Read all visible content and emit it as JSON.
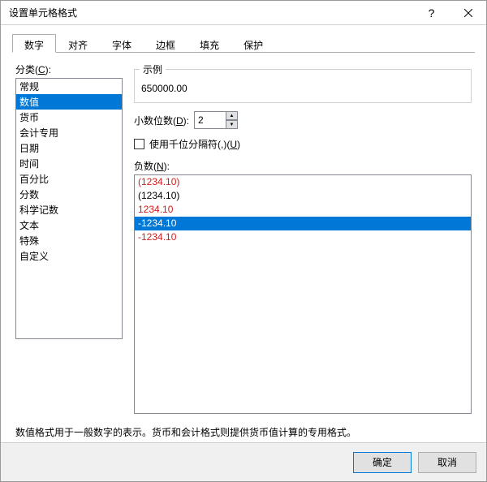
{
  "title": "设置单元格格式",
  "tabs": [
    "数字",
    "对齐",
    "字体",
    "边框",
    "填充",
    "保护"
  ],
  "active_tab_index": 0,
  "category": {
    "label_prefix": "分类(",
    "label_accel": "C",
    "label_suffix": "):",
    "items": [
      "常规",
      "数值",
      "货币",
      "会计专用",
      "日期",
      "时间",
      "百分比",
      "分数",
      "科学记数",
      "文本",
      "特殊",
      "自定义"
    ],
    "selected_index": 1
  },
  "sample": {
    "legend": "示例",
    "value": "650000.00"
  },
  "decimal": {
    "label_prefix": "小数位数(",
    "label_accel": "D",
    "label_suffix": "):",
    "value": "2"
  },
  "thousands": {
    "checked": false,
    "label_prefix": "使用千位分隔符(,)(",
    "label_accel": "U",
    "label_suffix": ")"
  },
  "negative": {
    "label_prefix": "负数(",
    "label_accel": "N",
    "label_suffix": "):",
    "items": [
      {
        "text": "(1234.10)",
        "red": true
      },
      {
        "text": "(1234.10)",
        "red": false
      },
      {
        "text": "1234.10",
        "red": true
      },
      {
        "text": "-1234.10",
        "red": false
      },
      {
        "text": "-1234.10",
        "red": true
      }
    ],
    "selected_index": 3
  },
  "description": "数值格式用于一般数字的表示。货币和会计格式则提供货币值计算的专用格式。",
  "buttons": {
    "ok": "确定",
    "cancel": "取消"
  }
}
